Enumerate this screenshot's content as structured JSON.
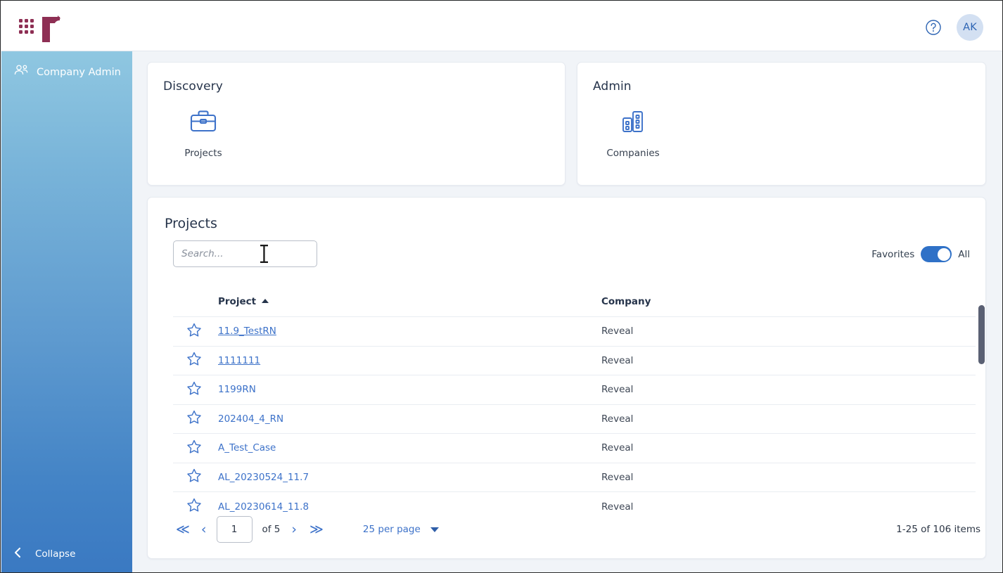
{
  "topbar": {
    "app_grid_icon": "apps-grid-icon",
    "logo": "reveal-r-logo",
    "logo_color": "#8e2f54",
    "help_icon": "help-circle-icon",
    "avatar_initials": "AK",
    "avatar_bg": "#d3e0f2",
    "avatar_text_color": "#2d64b3"
  },
  "sidebar": {
    "top_item": {
      "icon": "users-group-icon",
      "label": "Company Admin"
    },
    "collapse": {
      "icon": "chevron-left-icon",
      "label": "Collapse"
    },
    "gradient_top": "#8fc7e1",
    "gradient_bottom": "#3a79c2"
  },
  "cards": [
    {
      "title": "Discovery",
      "tiles": [
        {
          "icon": "briefcase-icon",
          "label": "Projects"
        }
      ]
    },
    {
      "title": "Admin",
      "tiles": [
        {
          "icon": "buildings-icon",
          "label": "Companies"
        }
      ]
    }
  ],
  "projects_panel": {
    "heading": "Projects",
    "search": {
      "value": "",
      "placeholder": "Search..."
    },
    "toggle": {
      "left_label": "Favorites",
      "right_label": "All",
      "state": "All",
      "on_color": "#2f71c7"
    },
    "table": {
      "columns": [
        "",
        "Project",
        "Company"
      ],
      "sort_column": "Project",
      "sort_direction": "ascending",
      "rows": [
        {
          "star": "star-outline-icon",
          "project": "11.9_TestRN",
          "company": "Reveal",
          "visited": true
        },
        {
          "star": "star-outline-icon",
          "project": "1111111",
          "company": "Reveal",
          "visited": true
        },
        {
          "star": "star-outline-icon",
          "project": "1199RN",
          "company": "Reveal",
          "visited": false
        },
        {
          "star": "star-outline-icon",
          "project": "202404_4_RN",
          "company": "Reveal",
          "visited": false
        },
        {
          "star": "star-outline-icon",
          "project": "A_Test_Case",
          "company": "Reveal",
          "visited": false
        },
        {
          "star": "star-outline-icon",
          "project": "AL_20230524_11.7",
          "company": "Reveal",
          "visited": false
        },
        {
          "star": "star-outline-icon",
          "project": "AL_20230614_11.8",
          "company": "Reveal",
          "visited": false
        }
      ]
    },
    "pagination": {
      "first_icon": "double-chevron-left-icon",
      "prev_icon": "chevron-left-icon",
      "page_value": "1",
      "of_label": "of 5",
      "next_icon": "chevron-right-icon",
      "last_icon": "double-chevron-right-icon",
      "per_page_label": "25 per page",
      "per_page_caret": "caret-down-icon",
      "items_count": "1-25 of 106 items"
    }
  }
}
